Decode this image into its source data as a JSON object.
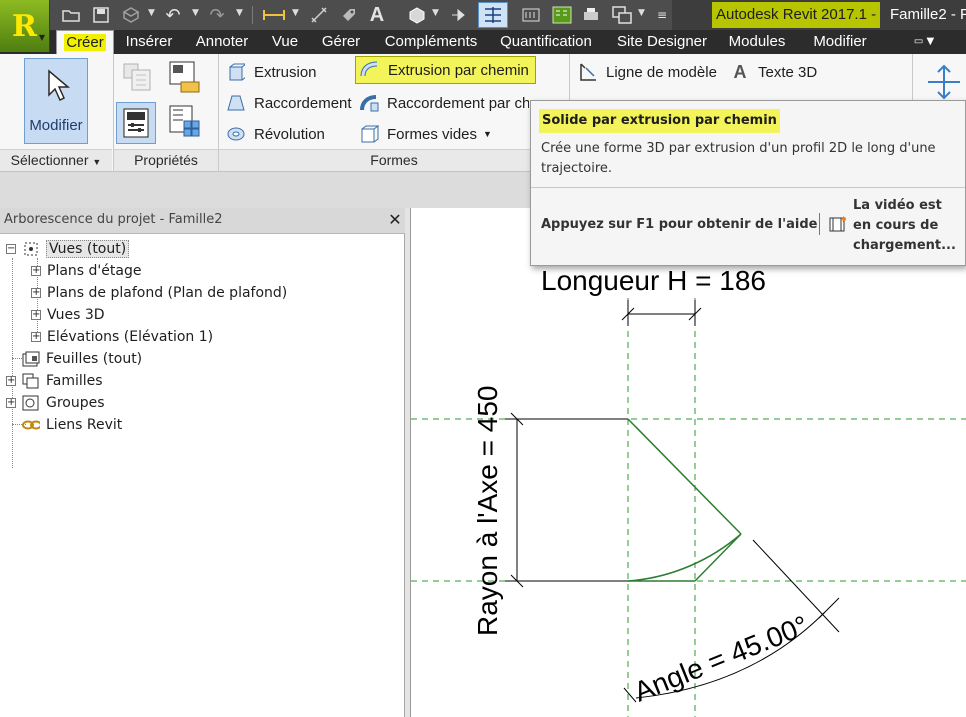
{
  "window": {
    "app_title": "Autodesk Revit 2017.1 -",
    "doc_title": "Famille2 - P",
    "app_button_letter": "R"
  },
  "tabs": [
    {
      "label": "Créer",
      "active": true
    },
    {
      "label": "Insérer"
    },
    {
      "label": "Annoter"
    },
    {
      "label": "Vue"
    },
    {
      "label": "Gérer"
    },
    {
      "label": "Compléments"
    },
    {
      "label": "Quantification"
    },
    {
      "label": "Site Designer"
    },
    {
      "label": "Modules"
    },
    {
      "label": "Modifier"
    }
  ],
  "ribbon": {
    "modify_label": "Modifier",
    "panels": {
      "select": "Sélectionner",
      "properties": "Propriétés",
      "forms": "Formes"
    },
    "forms": {
      "extrusion": "Extrusion",
      "blend": "Raccordement",
      "revolve": "Révolution",
      "sweep": "Extrusion par chemin",
      "swept_blend": "Raccordement par che",
      "void_forms": "Formes vides"
    },
    "model": {
      "model_line": "Ligne de modèle",
      "text_3d": "Texte 3D"
    }
  },
  "tooltip": {
    "title": "Solide par extrusion par chemin",
    "description": "Crée une forme 3D par extrusion d'un profil 2D le long d'une trajectoire.",
    "help": "Appuyez sur F1 pour obtenir de l'aide",
    "video": "La vidéo est en cours de chargement..."
  },
  "browser": {
    "title": "Arborescence du projet - Famille2",
    "close": "✕",
    "items": [
      {
        "label": "Vues (tout)",
        "expander": "−",
        "selected": true
      },
      {
        "label": "Plans d'étage",
        "expander": "+"
      },
      {
        "label": "Plans de plafond (Plan de plafond)",
        "expander": "+"
      },
      {
        "label": "Vues 3D",
        "expander": "+"
      },
      {
        "label": "Elévations (Elévation 1)",
        "expander": "+"
      },
      {
        "label": "Feuilles (tout)"
      },
      {
        "label": "Familles",
        "expander": "+"
      },
      {
        "label": "Groupes",
        "expander": "+"
      },
      {
        "label": "Liens Revit"
      }
    ]
  },
  "drawing": {
    "dim_length": "Longueur H = 186",
    "dim_radius": "Rayon à l'Axe = 450",
    "dim_angle": "Angle = 45.00°",
    "line_color": "#2e7d32",
    "ref_color": "#2e9a2e"
  },
  "colors": {
    "highlight": "#f3f35a",
    "active_blue": "#c7dcf2",
    "dark_bar": "#2c2c2c"
  }
}
